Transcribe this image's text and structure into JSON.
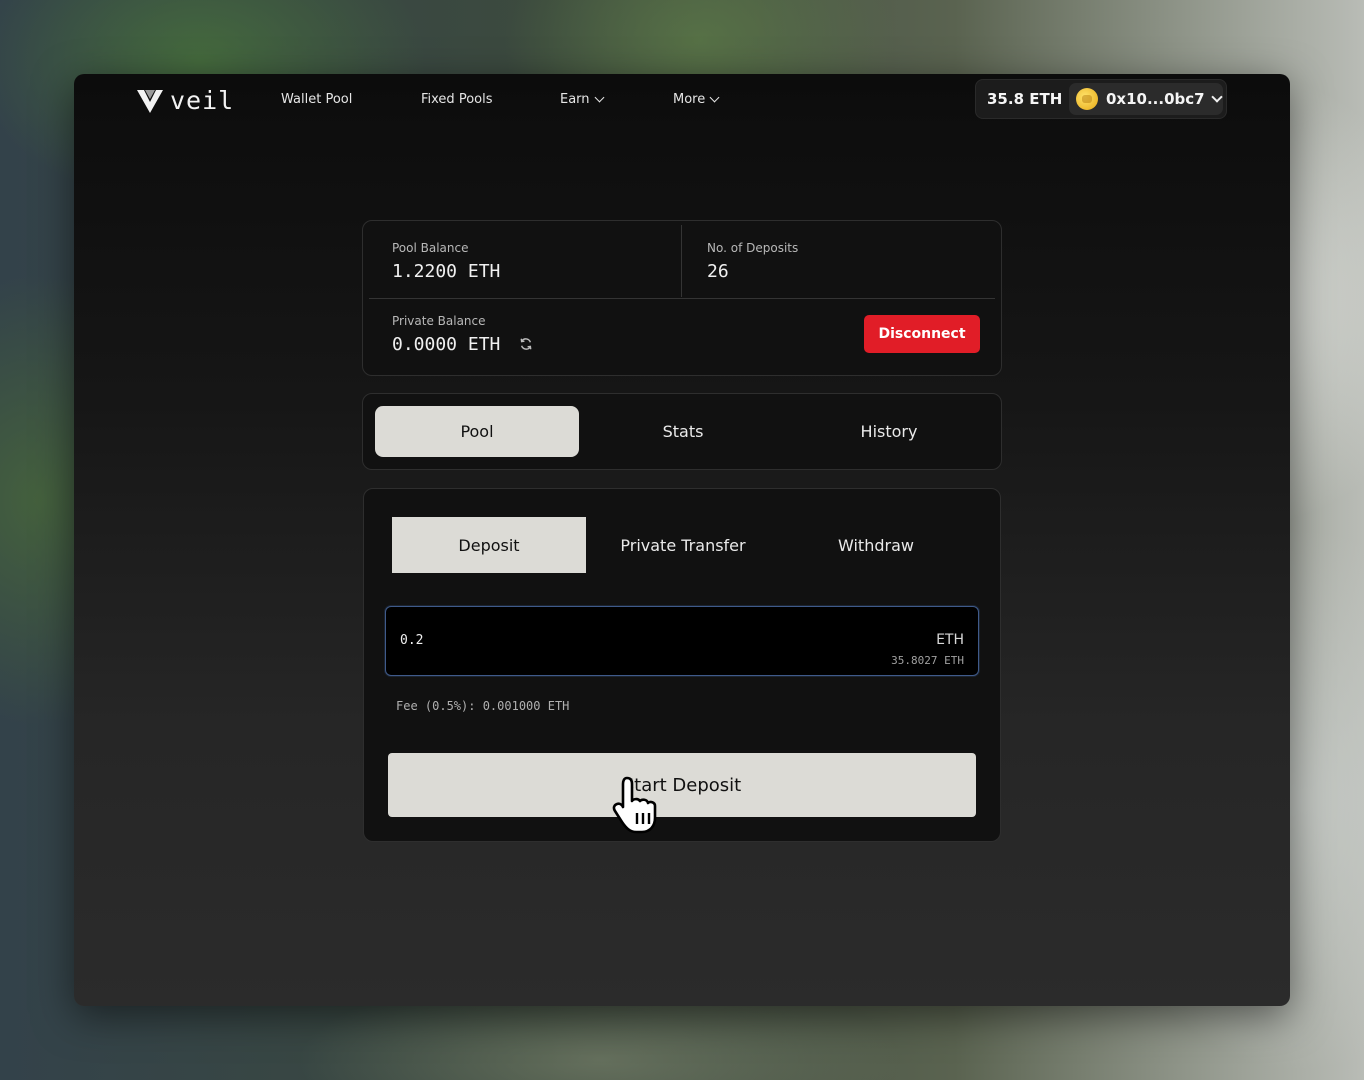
{
  "nav": {
    "brand": "veil",
    "links": [
      {
        "label": "Wallet Pool"
      },
      {
        "label": "Fixed Pools"
      },
      {
        "label": "Earn"
      },
      {
        "label": "More"
      }
    ],
    "wallet": {
      "balance": "35.8 ETH",
      "address": "0x10...0bc7"
    }
  },
  "stats": {
    "pool_balance_label": "Pool Balance",
    "pool_balance_value": "1.2200 ETH",
    "deposits_label": "No. of Deposits",
    "deposits_value": "26",
    "private_balance_label": "Private Balance",
    "private_balance_value": "0.0000 ETH",
    "disconnect_label": "Disconnect"
  },
  "tabs": [
    {
      "label": "Pool",
      "active": true
    },
    {
      "label": "Stats",
      "active": false
    },
    {
      "label": "History",
      "active": false
    }
  ],
  "form": {
    "subtabs": [
      {
        "label": "Deposit",
        "active": true
      },
      {
        "label": "Private Transfer",
        "active": false
      },
      {
        "label": "Withdraw",
        "active": false
      }
    ],
    "amount_value": "0.2",
    "unit": "ETH",
    "available": "35.8027 ETH",
    "fee": "Fee (0.5%): 0.001000 ETH",
    "submit_label": "Start Deposit"
  },
  "colors": {
    "accent_red": "#e11d27",
    "active_tab_bg": "#dcdbd6",
    "input_border": "#3f5a8a"
  }
}
